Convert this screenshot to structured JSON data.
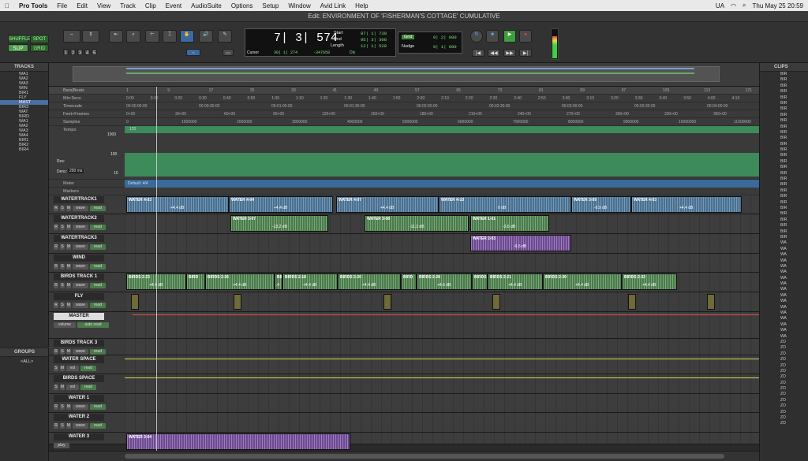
{
  "menubar": {
    "app": "Pro Tools",
    "items": [
      "File",
      "Edit",
      "View",
      "Track",
      "Clip",
      "Event",
      "AudioSuite",
      "Options",
      "Setup",
      "Window",
      "Avid Link",
      "Help"
    ],
    "keyboard": "UA",
    "datetime": "Thu May 25  20:59"
  },
  "window_title": "Edit: ENVIRONMENT OF 'FISHERMAN'S COTTAGE' CUMULATIVE",
  "toolbar": {
    "modes": [
      "SHUFFLE",
      "SPOT",
      "SLIP",
      "GRID"
    ],
    "zoom_presets": [
      "1",
      "2",
      "3",
      "4",
      "5"
    ],
    "main_counter": "7| 3| 574",
    "start_label": "Start",
    "end_label": "End",
    "length_label": "Length",
    "start_value": "87| 1| 739",
    "end_value": "95| 3| 308",
    "length_value": "12| 1| 529",
    "cursor_label": "Cursor",
    "cursor_value": "30| 1| 274",
    "cursor_db": "-347658",
    "dly_label": "Dly",
    "grid_label": "Grid",
    "grid_value": "0| 2| 000",
    "nudge_label": "Nudge",
    "nudge_value": "0| 1| 000"
  },
  "tracks_panel": {
    "title": "TRACKS",
    "items": [
      "WA1",
      "WA2",
      "WA3",
      "WIN",
      "BIR1",
      "FLY",
      "MAST",
      "BIR3",
      "WAT",
      "BIRD",
      "WA1",
      "WA2",
      "WA3",
      "WA4",
      "BIR1",
      "BIR2",
      "BIR4"
    ],
    "selected_index": 6
  },
  "groups_panel": {
    "title": "GROUPS",
    "item": "<ALL>"
  },
  "clips_panel": {
    "title": "CLIPS",
    "items": [
      "BIR",
      "BIR",
      "BIR",
      "BIR",
      "BIR",
      "BIR",
      "BIR",
      "BIR",
      "BIR",
      "BIR",
      "BIR",
      "BIR",
      "BIR",
      "BIR",
      "BIR",
      "BIR",
      "BIR",
      "BIR",
      "BIR",
      "BIR",
      "BIR",
      "BIR",
      "BIR",
      "BIR",
      "BIR",
      "BIR",
      "BIR",
      "BIR",
      "BIR",
      "WA",
      "WA",
      "WA",
      "WA",
      "WA",
      "WA",
      "WA",
      "WA",
      "WA",
      "WA",
      "WA",
      "WA",
      "WA",
      "WA",
      "WA",
      "WA",
      "WA",
      "ZO",
      "ZO",
      "ZO",
      "ZO",
      "ZO",
      "ZO",
      "ZO",
      "ZO",
      "ZO",
      "ZO",
      "ZO",
      "ZO",
      "ZO",
      "ZO",
      "ZO"
    ]
  },
  "rulers": {
    "bars_label": "Bars|Beats",
    "minsecs_label": "Min:Secs",
    "timecode_label": "Timecode",
    "feetframes_label": "Feet+Frames",
    "samples_label": "Samples",
    "tempo_label": "Tempo",
    "tempo_value": "120",
    "tempo_axis": [
      "1000",
      "100",
      "10"
    ],
    "res_label": "Res:",
    "dens_label": "Dens:",
    "dens_value": "250 ms",
    "meter_label": "Meter",
    "meter_value": "Default: 4/4",
    "markers_label": "Markers",
    "bars_ticks": [
      "1",
      "9",
      "17",
      "25",
      "33",
      "41",
      "49",
      "57",
      "65",
      "73",
      "81",
      "89",
      "97",
      "105",
      "113",
      "121"
    ],
    "minsecs_ticks": [
      "0:00",
      "0:10",
      "0:20",
      "0:30",
      "0:40",
      "0:50",
      "1:00",
      "1:10",
      "1:20",
      "1:30",
      "1:40",
      "1:50",
      "2:00",
      "2:10",
      "2:20",
      "2:30",
      "2:40",
      "2:50",
      "3:00",
      "3:10",
      "3:20",
      "3:30",
      "3:40",
      "3:50",
      "4:00",
      "4:10"
    ],
    "timecode_ticks": [
      "00:00:00:00",
      "00:00:30:00",
      "00:01:00:00",
      "00:01:30:00",
      "00:02:00:00",
      "00:02:30:00",
      "00:03:00:00",
      "00:03:30:00",
      "00:04:00:00"
    ],
    "feet_ticks": [
      "0+00",
      "30+00",
      "60+00",
      "90+00",
      "120+00",
      "150+00",
      "180+00",
      "210+00",
      "240+00",
      "270+00",
      "300+00",
      "330+00",
      "360+00"
    ],
    "samples_ticks": [
      "0",
      "1000000",
      "2000000",
      "3000000",
      "4000000",
      "5000000",
      "6000000",
      "7000000",
      "8000000",
      "9000000",
      "10000000",
      "11000000"
    ]
  },
  "tracks": [
    {
      "name": "WATERTRACK1",
      "btns": [
        "R",
        "S",
        "M",
        "wave",
        "read"
      ]
    },
    {
      "name": "WATERTRACK2",
      "btns": [
        "R",
        "S",
        "M",
        "wave",
        "read"
      ]
    },
    {
      "name": "WATERTRACK3",
      "btns": [
        "R",
        "S",
        "M",
        "wave",
        "read"
      ]
    },
    {
      "name": "WIND",
      "btns": [
        "R",
        "S",
        "M",
        "wave",
        "read"
      ]
    },
    {
      "name": "BIRDS TRACK 1",
      "btns": [
        "R",
        "S",
        "M",
        "wave",
        "read"
      ]
    },
    {
      "name": "FLY",
      "btns": [
        "R",
        "S",
        "M",
        "wave",
        "read"
      ]
    },
    {
      "name": "MASTER",
      "btns": [
        "volume",
        "auto read"
      ]
    },
    {
      "name": "BIRDS TRACK 3",
      "btns": [
        "R",
        "S",
        "M",
        "wave",
        "read"
      ]
    },
    {
      "name": "WATER SPACE",
      "btns": [
        "S",
        "M",
        "vol",
        "read"
      ]
    },
    {
      "name": "BIRDS SPACE",
      "btns": [
        "S",
        "M",
        "vol",
        "read"
      ]
    },
    {
      "name": "WATER 1",
      "btns": [
        "R",
        "S",
        "M",
        "wave",
        "read"
      ]
    },
    {
      "name": "WATER 2",
      "btns": [
        "R",
        "S",
        "M",
        "wave",
        "read"
      ]
    },
    {
      "name": "WATER 3",
      "btns": [
        "play"
      ]
    }
  ],
  "clips": {
    "wt1": [
      {
        "name": "WATER 4-03",
        "gain": "+4.4 dB"
      },
      {
        "name": "WATER 4-04",
        "gain": "+4.4 dB"
      },
      {
        "name": "WATER 4-07",
        "gain": "+4.4 dB"
      },
      {
        "name": "WATER 4-10",
        "gain": "0 dB"
      },
      {
        "name": "WATER 3-09",
        "gain": "-8.9 dB"
      },
      {
        "name": "WATER 4-03",
        "gain": "+4.4 dB"
      }
    ],
    "wt2": [
      {
        "name": "WATER 3-07",
        "gain": "-13.2 dB"
      },
      {
        "name": "WATER 3-08",
        "gain": "-11.3 dB"
      },
      {
        "name": "WATER 1-01",
        "gain": "-3.6 dB"
      }
    ],
    "wt3": [
      {
        "name": "WATER 2-03",
        "gain": "-6.5 dB"
      }
    ],
    "birds1": [
      {
        "name": "BIRDS 2-23",
        "gain": "+4.4 dB"
      },
      {
        "name": "BIRD",
        "gain": ""
      },
      {
        "name": "BIRDS 2-26",
        "gain": "+4.4 dB"
      },
      {
        "name": "BIRDS 2",
        "gain": "+4.4"
      },
      {
        "name": "BIRDS 2-18",
        "gain": "+4.4 dB"
      },
      {
        "name": "BIRDS 2-20",
        "gain": "+4.4 dB"
      },
      {
        "name": "BIRD",
        "gain": ""
      },
      {
        "name": "BIRDS 2-28",
        "gain": "+4.6 dB"
      },
      {
        "name": "BIRDS 2",
        "gain": ""
      },
      {
        "name": "BIRDS 2-21",
        "gain": "+4.4 dB"
      },
      {
        "name": "BIRDS 2-30",
        "gain": "+4.4 dB"
      },
      {
        "name": "BIRDS 2-32",
        "gain": "+4.4 dB"
      }
    ],
    "water3": [
      {
        "name": "WATER 3-04",
        "gain": ""
      }
    ]
  },
  "colors": {
    "accent": "#7fe37f",
    "selection": "#4a6fa0",
    "clip_blue": "#4a7090",
    "clip_green": "#4c7a4c",
    "clip_purple": "#6c4a90",
    "master_auto": "#e05050",
    "space_auto": "#d8d850"
  }
}
